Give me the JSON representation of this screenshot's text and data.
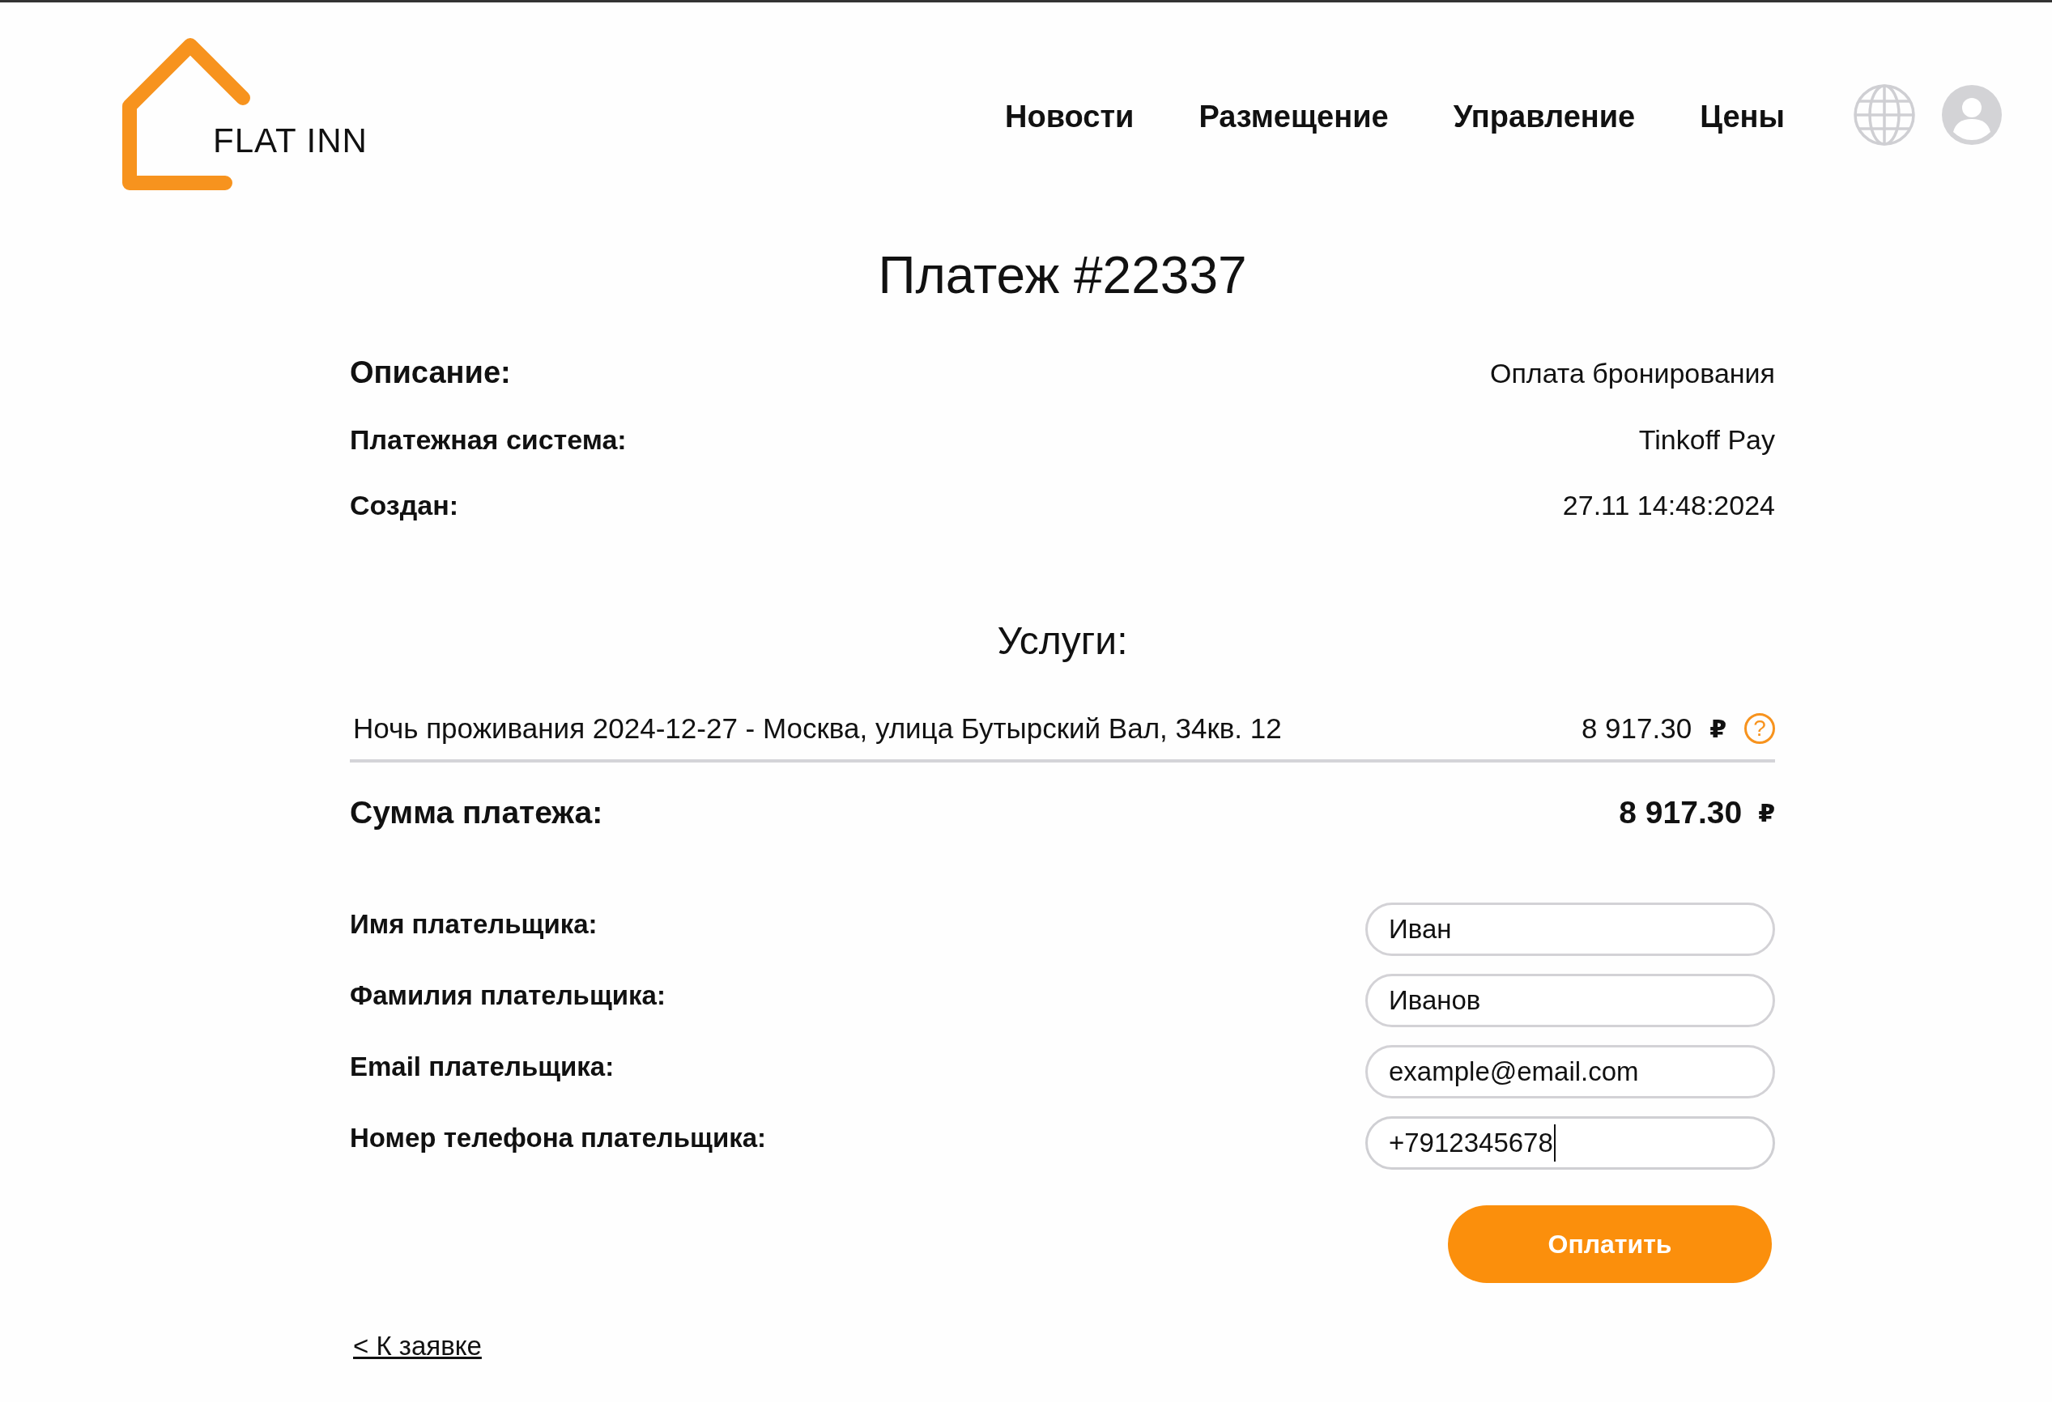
{
  "header": {
    "logo_text": "FLAT INN",
    "nav": [
      "Новости",
      "Размещение",
      "Управление",
      "Цены"
    ]
  },
  "title": "Платеж #22337",
  "details": [
    {
      "label": "Описание:",
      "value": "Оплата бронирования",
      "emphasis": true
    },
    {
      "label": "Платежная система:",
      "value": "Tinkoff Pay",
      "emphasis": false
    },
    {
      "label": "Создан:",
      "value": "27.11 14:48:2024",
      "emphasis": false
    }
  ],
  "services_heading": "Услуги:",
  "services": [
    {
      "name": "Ночь проживания 2024-12-27 - Москва, улица Бутырский Вал, 34кв. 12",
      "price": "8 917.30",
      "currency": "₽",
      "help": "?"
    }
  ],
  "total": {
    "label": "Сумма платежа:",
    "value": "8 917.30",
    "currency": "₽"
  },
  "fields": [
    {
      "label": "Имя плательщика:",
      "value": "Иван",
      "focused": false
    },
    {
      "label": "Фамилия плательщика:",
      "value": "Иванов",
      "focused": false
    },
    {
      "label": "Email плательщика:",
      "value": "example@email.com",
      "focused": false
    },
    {
      "label": "Номер телефона плательщика:",
      "value": "+7912345678",
      "focused": true
    }
  ],
  "pay_button": "Оплатить",
  "back_link": "< К заявке"
}
